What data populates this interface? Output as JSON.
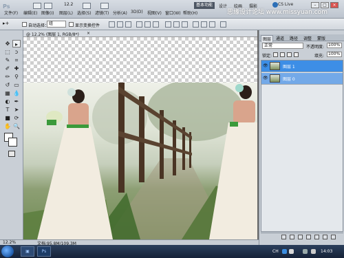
{
  "menubar": {
    "logo": "Ps",
    "items": [
      "文件(F)",
      "编辑(E)",
      "图像(I)",
      "图层(L)",
      "选择(S)",
      "滤镜(T)",
      "分析(A)",
      "3D(D)",
      "视图(V)",
      "窗口(W)",
      "帮助(H)"
    ],
    "zoom": "12.2",
    "workspace": "基本功能",
    "workspace_links": [
      "设计",
      "绘画",
      "摄影"
    ],
    "cslive": "CS Live",
    "watermark": "思缘设计论坛 www.missyuan.com"
  },
  "options": {
    "auto_select_label": "自动选择：",
    "auto_select_value": "组",
    "show_transform_label": "显示变换控件"
  },
  "document": {
    "tab_title": "@ 12.2% (图层 1, RGB/8*)",
    "close": "×"
  },
  "status": {
    "zoom": "12.2%",
    "doc_info": "文档:95.8M/109.3M"
  },
  "layers_panel": {
    "tabs": [
      "图层",
      "通道",
      "路径",
      "调整",
      "蒙版"
    ],
    "blend_mode": "正常",
    "opacity_label": "不透明度:",
    "opacity": "100%",
    "lock_label": "锁定:",
    "fill_label": "填充:",
    "fill": "100%",
    "layers": [
      {
        "name": "图层 1"
      },
      {
        "name": "图层 0"
      }
    ]
  },
  "taskbar": {
    "tray_lang": "CH",
    "time": "14:03"
  }
}
